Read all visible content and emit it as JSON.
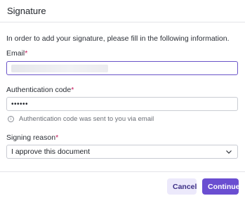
{
  "dialog": {
    "title": "Signature",
    "intro": "In order to add your signature, please fill in the following information."
  },
  "fields": {
    "email": {
      "label": "Email",
      "required_mark": "*",
      "value": ""
    },
    "auth_code": {
      "label": "Authentication code",
      "required_mark": "*",
      "value": "••••••",
      "hint": "Authentication code was sent to you via email"
    },
    "signing_reason": {
      "label": "Signing reason",
      "required_mark": "*",
      "selected": "I approve this document"
    }
  },
  "buttons": {
    "cancel": "Cancel",
    "continue": "Continue"
  },
  "colors": {
    "accent": "#6a4ed1",
    "required": "#c2185b",
    "cancel_bg": "#ece9fb"
  },
  "icons": {
    "hint": "info-icon",
    "select": "chevron-down-icon"
  }
}
